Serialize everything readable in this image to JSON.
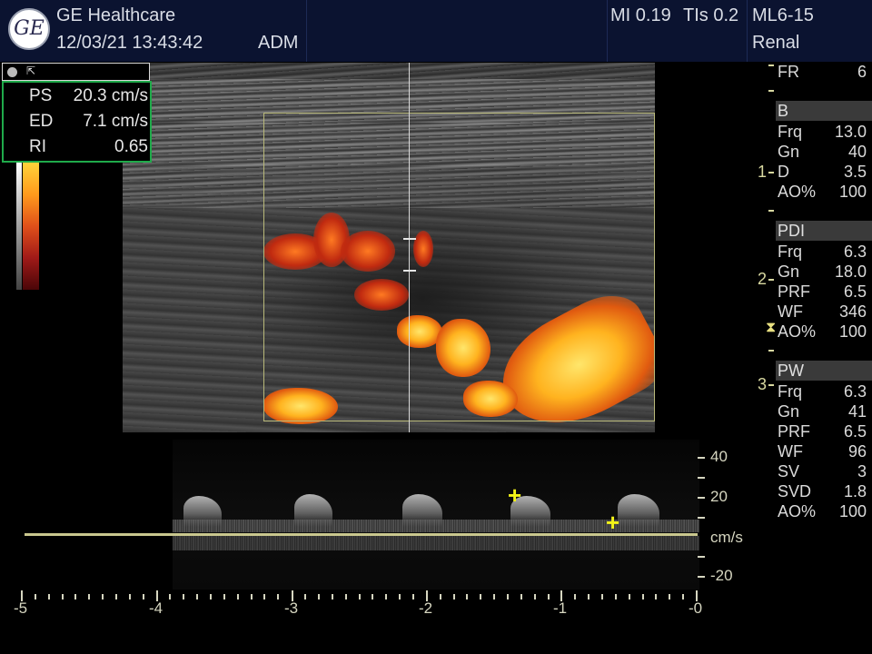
{
  "header": {
    "logo_text": "GE",
    "brand": "GE Healthcare",
    "datetime": "12/03/21 13:43:42",
    "operator": "ADM",
    "mi": "MI 0.19",
    "tis": "TIs 0.2",
    "probe": "ML6-15",
    "preset": "Renal"
  },
  "measurement_box": {
    "mini_icon": "pointer-icon",
    "rows": [
      {
        "label": "PS",
        "value": "20.3 cm/s"
      },
      {
        "label": "ED",
        "value": "7.1 cm/s"
      },
      {
        "label": "RI",
        "value": "0.65"
      }
    ]
  },
  "right_panel": {
    "fr": {
      "label": "FR",
      "value": "6"
    },
    "sections": [
      {
        "title": "B",
        "rows": [
          {
            "label": "Frq",
            "value": "13.0"
          },
          {
            "label": "Gn",
            "value": "40"
          },
          {
            "label": "D",
            "value": "3.5"
          },
          {
            "label": "AO%",
            "value": "100"
          }
        ]
      },
      {
        "title": "PDI",
        "rows": [
          {
            "label": "Frq",
            "value": "6.3"
          },
          {
            "label": "Gn",
            "value": "18.0"
          },
          {
            "label": "PRF",
            "value": "6.5"
          },
          {
            "label": "WF",
            "value": "346"
          },
          {
            "label": "AO%",
            "value": "100"
          }
        ]
      },
      {
        "title": "PW",
        "rows": [
          {
            "label": "Frq",
            "value": "6.3"
          },
          {
            "label": "Gn",
            "value": "41"
          },
          {
            "label": "PRF",
            "value": "6.5"
          },
          {
            "label": "WF",
            "value": "96"
          },
          {
            "label": "SV",
            "value": "3"
          },
          {
            "label": "SVD",
            "value": "1.8"
          },
          {
            "label": "AO%",
            "value": "100"
          }
        ]
      }
    ],
    "depth_marks": [
      "1",
      "2",
      "3"
    ],
    "hourglass_icon": "hourglass-icon"
  },
  "spectrum": {
    "velocity_labels": [
      "40",
      "20",
      "cm/s",
      "-20"
    ],
    "time_labels": [
      "-5",
      "-4",
      "-3",
      "-2",
      "-1",
      "-0"
    ]
  },
  "colors": {
    "header_bg": "#0b1330",
    "measurement_border": "#1faa4a",
    "baseline": "#c9c78e",
    "caliper": "#f3f318"
  }
}
